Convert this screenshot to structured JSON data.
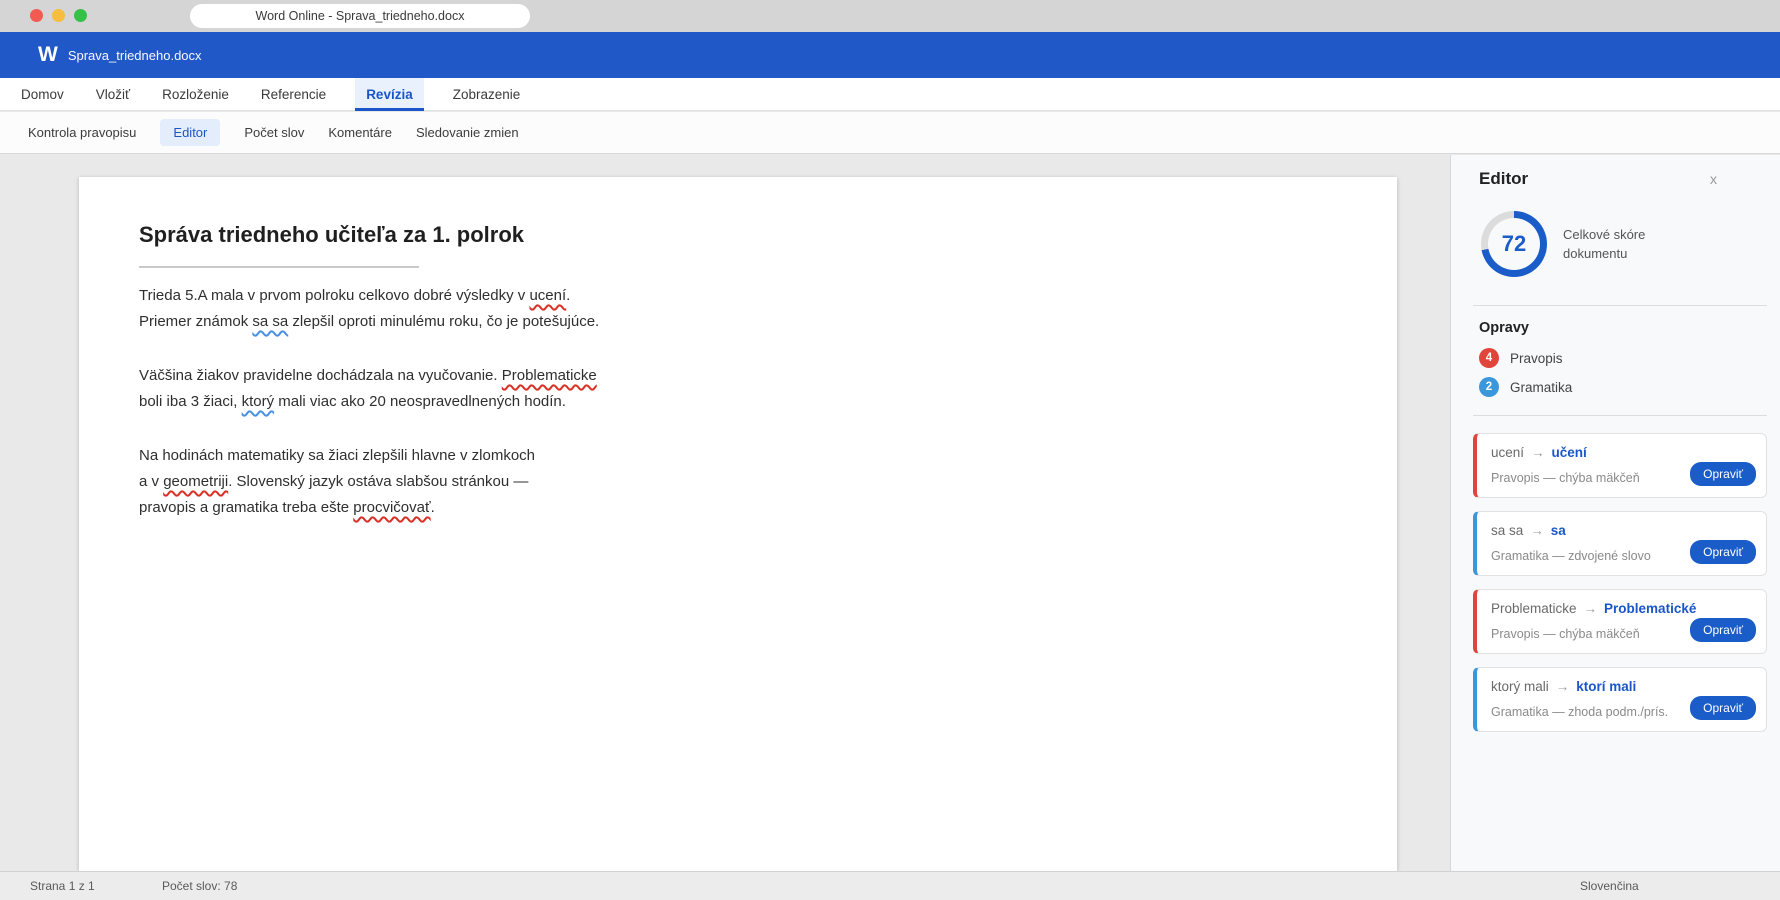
{
  "window": {
    "title": "Word Online - Sprava_triedneho.docx"
  },
  "appbar": {
    "logo": "W",
    "filename": "Sprava_triedneho.docx"
  },
  "ribbon": {
    "tabs": [
      {
        "id": "domov",
        "label": "Domov",
        "active": false
      },
      {
        "id": "vlozit",
        "label": "Vložiť",
        "active": false
      },
      {
        "id": "rozlozenie",
        "label": "Rozloženie",
        "active": false
      },
      {
        "id": "referencie",
        "label": "Referencie",
        "active": false
      },
      {
        "id": "revizia",
        "label": "Revízia",
        "active": true
      },
      {
        "id": "zobrazenie",
        "label": "Zobrazenie",
        "active": false
      }
    ]
  },
  "toolbar": {
    "items": [
      {
        "id": "kontrola-pravopisu",
        "label": "Kontrola pravopisu",
        "active": false
      },
      {
        "id": "editor",
        "label": "Editor",
        "active": true
      },
      {
        "id": "pocet-slov",
        "label": "Počet slov",
        "active": false
      },
      {
        "id": "komentare",
        "label": "Komentáre",
        "active": false
      },
      {
        "id": "sledovanie-zmien",
        "label": "Sledovanie zmien",
        "active": false
      }
    ]
  },
  "document": {
    "title": "Správa triedneho učiteľa za 1. polrok",
    "paragraphs": [
      {
        "lines": [
          [
            {
              "text": "Trieda 5.A mala v prvom polroku celkovo dobré výsledky v ",
              "mark": "none"
            },
            {
              "text": "ucení",
              "mark": "red"
            },
            {
              "text": ".",
              "mark": "none"
            }
          ],
          [
            {
              "text": "Priemer známok ",
              "mark": "none"
            },
            {
              "text": "sa sa",
              "mark": "blue"
            },
            {
              "text": " zlepšil oproti minulému roku, čo je potešujúce.",
              "mark": "none"
            }
          ]
        ]
      },
      {
        "lines": [
          [
            {
              "text": "Väčšina žiakov pravidelne dochádzala na vyučovanie. ",
              "mark": "none"
            },
            {
              "text": "Problematicke",
              "mark": "red"
            }
          ],
          [
            {
              "text": "boli iba 3 žiaci, ",
              "mark": "none"
            },
            {
              "text": "ktorý",
              "mark": "blue"
            },
            {
              "text": " mali viac ako 20 neospravedlnených hodín.",
              "mark": "none"
            }
          ]
        ]
      },
      {
        "lines": [
          [
            {
              "text": "Na hodinách matematiky sa žiaci zlepšili hlavne v zlomkoch",
              "mark": "none"
            }
          ],
          [
            {
              "text": "a v ",
              "mark": "none"
            },
            {
              "text": "geometriji",
              "mark": "red"
            },
            {
              "text": ". Slovenský jazyk ostáva slabšou stránkou —",
              "mark": "none"
            }
          ],
          [
            {
              "text": "pravopis a gramatika treba ešte ",
              "mark": "none"
            },
            {
              "text": "procvičovať",
              "mark": "red"
            },
            {
              "text": ".",
              "mark": "none"
            }
          ]
        ]
      }
    ]
  },
  "editor_panel": {
    "title": "Editor",
    "close_glyph": "x",
    "score": {
      "value": 72,
      "label": "Celkové skóre dokumentu"
    },
    "corrections_heading": "Opravy",
    "categories": [
      {
        "id": "pravopis",
        "count": 4,
        "label": "Pravopis",
        "color": "red"
      },
      {
        "id": "gramatika",
        "count": 2,
        "label": "Gramatika",
        "color": "blue"
      }
    ],
    "arrow_glyph": "→",
    "corrections": [
      {
        "original": "ucení",
        "corrected": "učení",
        "description": "Pravopis — chýba mäkčeň",
        "type": "red",
        "action_label": "Opraviť"
      },
      {
        "original": "sa sa",
        "corrected": "sa",
        "description": "Gramatika — zdvojené slovo",
        "type": "blue",
        "action_label": "Opraviť"
      },
      {
        "original": "Problematicke",
        "corrected": "Problematické",
        "description": "Pravopis — chýba mäkčeň",
        "type": "red",
        "action_label": "Opraviť"
      },
      {
        "original": "ktorý mali",
        "corrected": "ktorí mali",
        "description": "Gramatika — zhoda podm./prís.",
        "type": "blue",
        "action_label": "Opraviť"
      }
    ]
  },
  "statusbar": {
    "page": "Strana 1 z 1",
    "word_count": "Počet slov: 78",
    "language": "Slovenčina"
  },
  "colors": {
    "app-blue": "#2158c8",
    "accent-blue": "#1a56c9",
    "button-blue": "#1a5dc9",
    "score-ring": "#1a5dc9",
    "category-red": "#e0453c",
    "category-blue": "#3b97dc",
    "squiggle-red": "#d93025",
    "squiggle-blue": "#4a90e2",
    "traffic-red": "#f15b51",
    "traffic-yellow": "#f6bd3e",
    "traffic-green": "#35c148"
  }
}
